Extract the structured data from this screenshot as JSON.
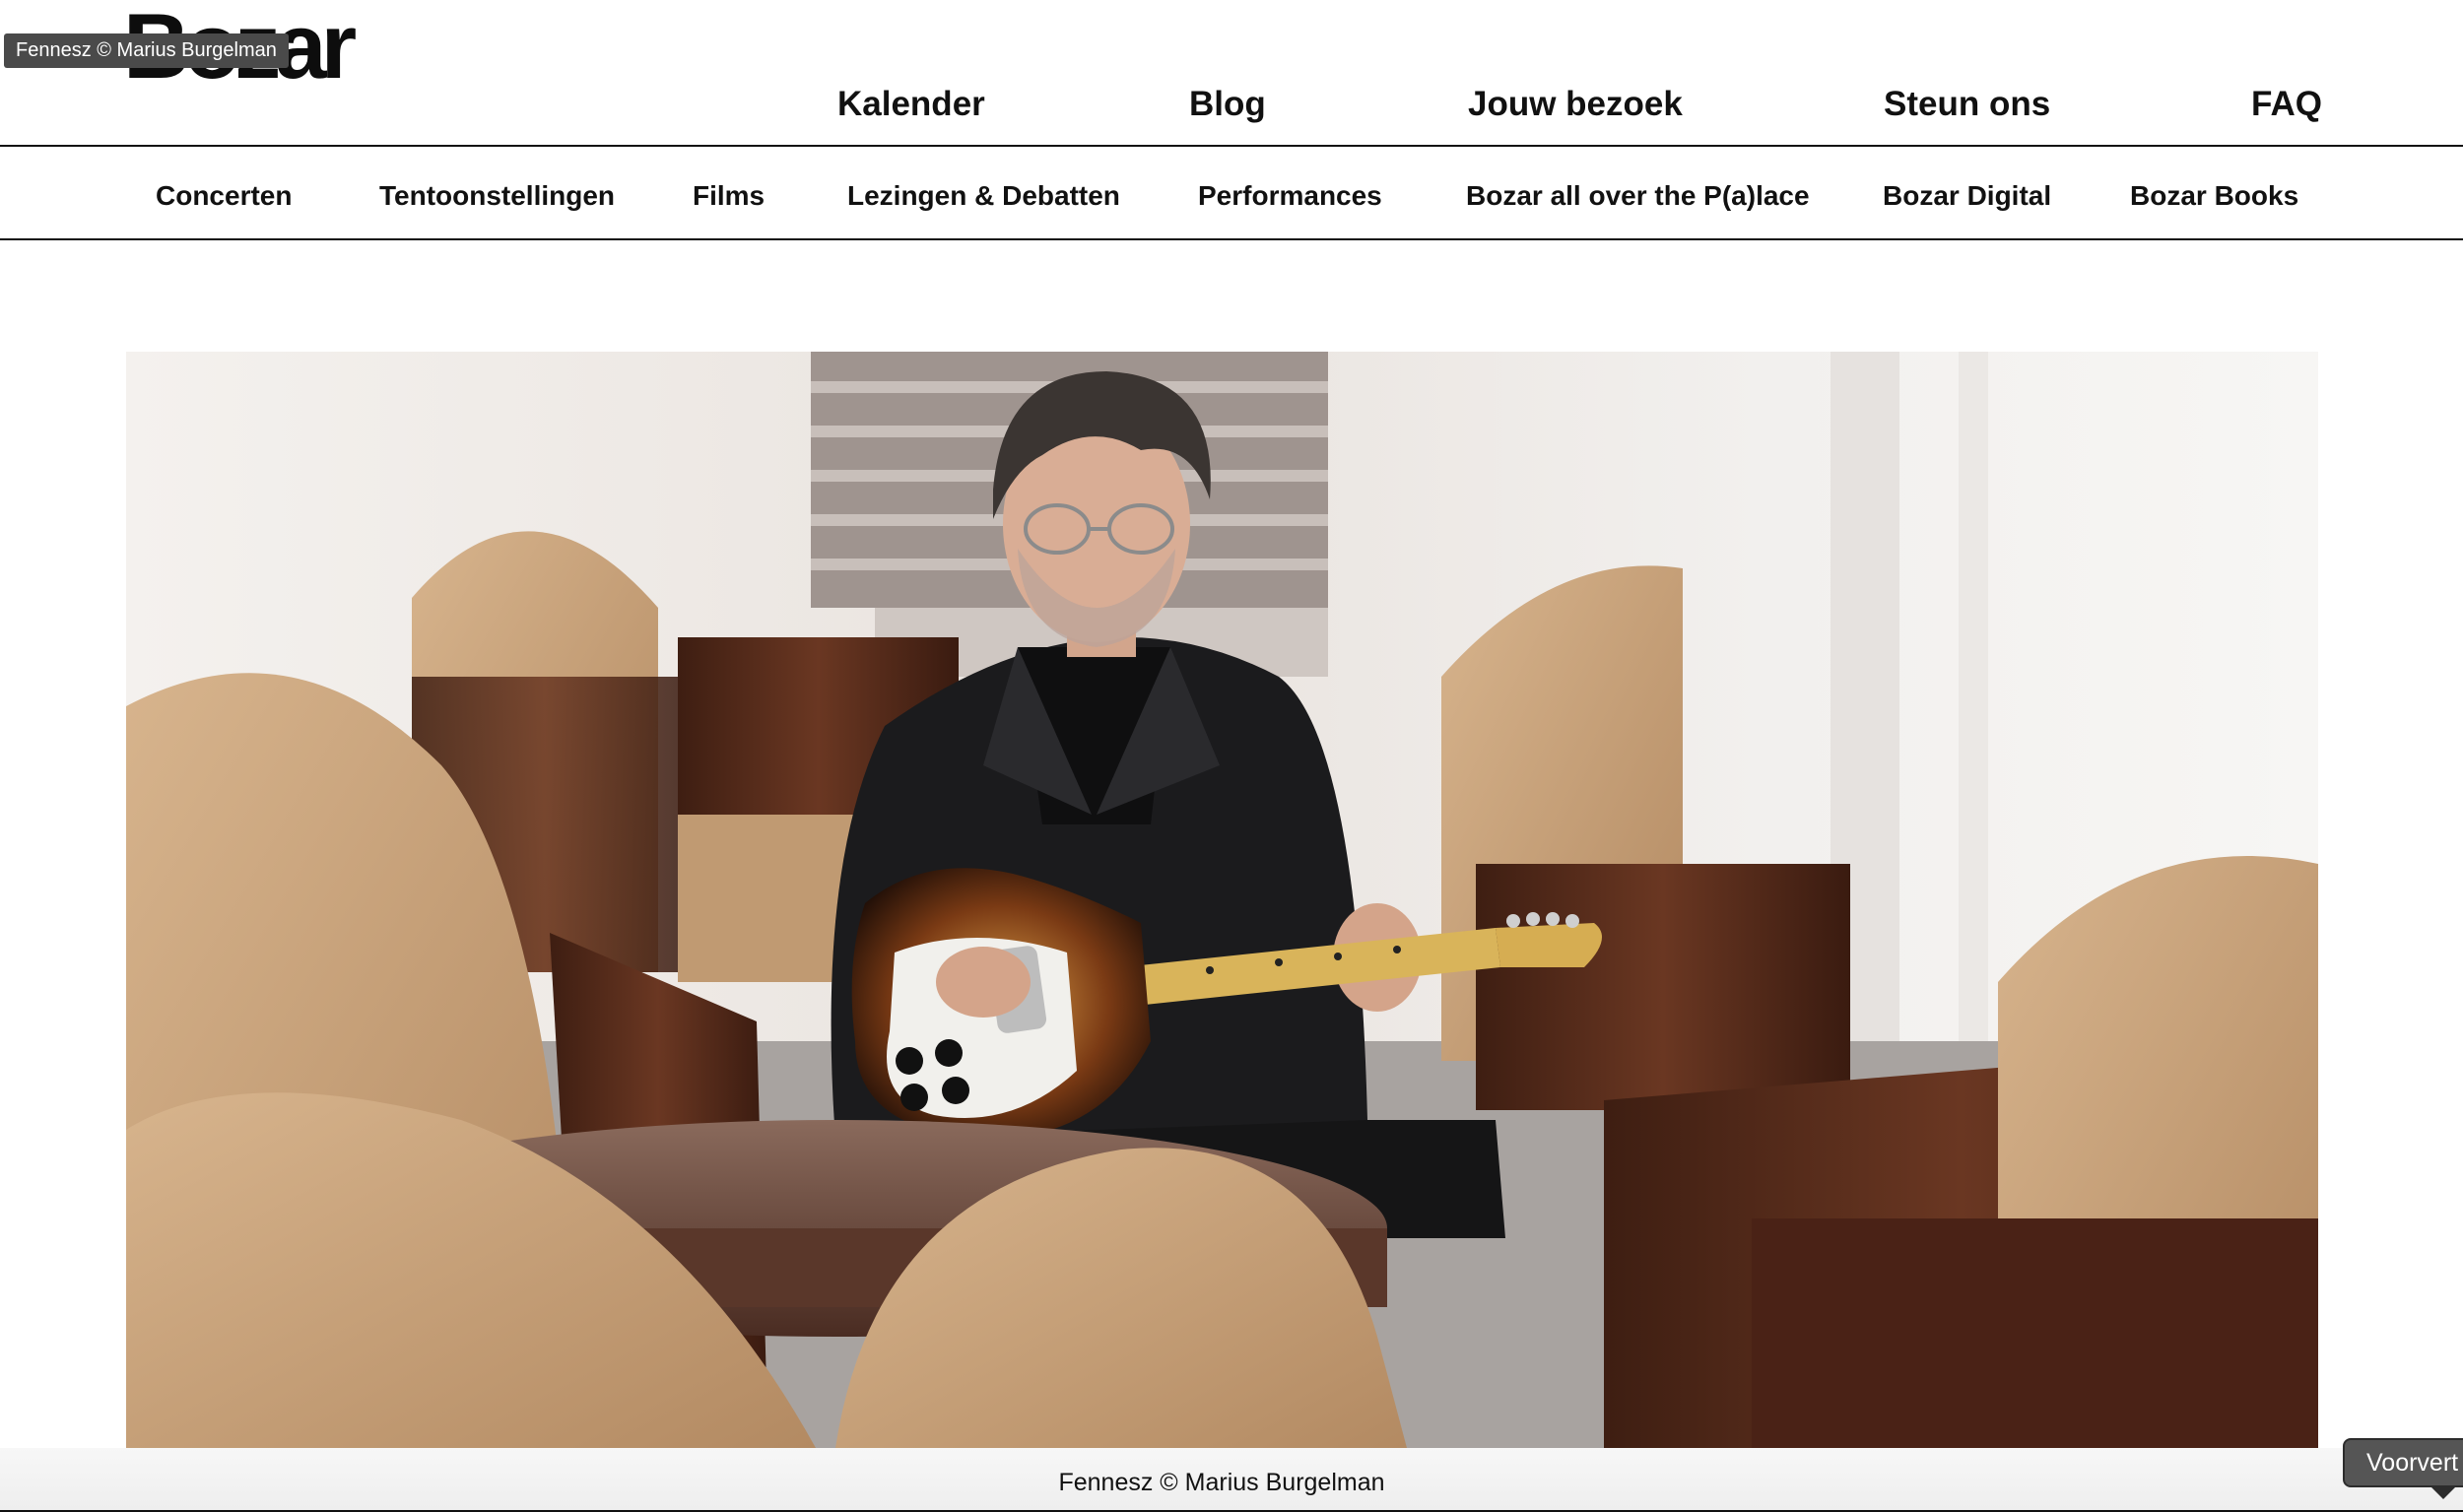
{
  "header": {
    "logo_text": "Bozar",
    "photo_tooltip": "Fennesz © Marius Burgelman",
    "main_nav": [
      {
        "label": "Kalender"
      },
      {
        "label": "Blog"
      },
      {
        "label": "Jouw bezoek"
      },
      {
        "label": "Steun ons"
      },
      {
        "label": "FAQ"
      }
    ]
  },
  "sub_nav": [
    {
      "label": "Concerten"
    },
    {
      "label": "Tentoonstellingen"
    },
    {
      "label": "Films"
    },
    {
      "label": "Lezingen & Debatten"
    },
    {
      "label": "Performances"
    },
    {
      "label": "Bozar all over the P(a)lace"
    },
    {
      "label": "Bozar Digital"
    },
    {
      "label": "Bozar Books"
    }
  ],
  "hero": {
    "caption": "Fennesz © Marius Burgelman"
  },
  "corner_tooltip": "Voorvert",
  "colors": {
    "armchair": "#c9a27a",
    "wood": "#5b2e1d",
    "jacket": "#1b1b1d",
    "guitar_neck": "#d9b45a"
  }
}
